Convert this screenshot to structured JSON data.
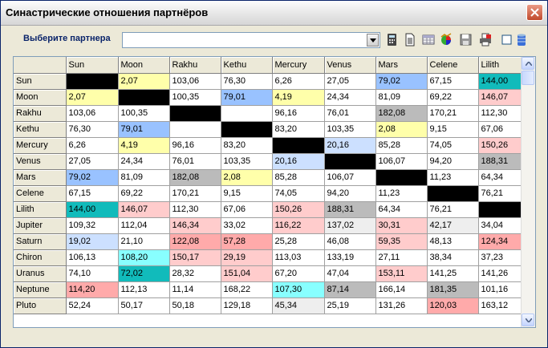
{
  "window": {
    "title": "Синастрические отношения партнёров"
  },
  "toolbar": {
    "partner_label": "Выберите партнера",
    "partner_value": "",
    "icons": [
      "calculator-icon",
      "document-icon",
      "table-icon",
      "chart-icon",
      "save-icon",
      "print-icon",
      "checkbox-icon",
      "database-icon"
    ]
  },
  "grid": {
    "columns": [
      "Sun",
      "Moon",
      "Rakhu",
      "Kethu",
      "Mercury",
      "Venus",
      "Mars",
      "Celene",
      "Lilith"
    ],
    "rows": [
      {
        "name": "Sun",
        "cells": [
          {
            "v": "",
            "c": "#000000"
          },
          {
            "v": "2,07",
            "c": "#ffffaa"
          },
          {
            "v": "103,06",
            "c": ""
          },
          {
            "v": "76,30",
            "c": ""
          },
          {
            "v": "6,26",
            "c": ""
          },
          {
            "v": "27,05",
            "c": ""
          },
          {
            "v": "79,02",
            "c": "#99c2ff"
          },
          {
            "v": "67,15",
            "c": ""
          },
          {
            "v": "144,00",
            "c": "#11bbbb"
          }
        ]
      },
      {
        "name": "Moon",
        "cells": [
          {
            "v": "2,07",
            "c": "#ffffaa"
          },
          {
            "v": "",
            "c": "#000000"
          },
          {
            "v": "100,35",
            "c": ""
          },
          {
            "v": "79,01",
            "c": "#99c2ff"
          },
          {
            "v": "4,19",
            "c": "#ffffaa"
          },
          {
            "v": "24,34",
            "c": ""
          },
          {
            "v": "81,09",
            "c": ""
          },
          {
            "v": "69,22",
            "c": ""
          },
          {
            "v": "146,07",
            "c": "#ffcccc"
          }
        ]
      },
      {
        "name": "Rakhu",
        "cells": [
          {
            "v": "103,06",
            "c": ""
          },
          {
            "v": "100,35",
            "c": ""
          },
          {
            "v": "",
            "c": "#000000"
          },
          {
            "v": "",
            "c": ""
          },
          {
            "v": "96,16",
            "c": ""
          },
          {
            "v": "76,01",
            "c": ""
          },
          {
            "v": "182,08",
            "c": "#bbbbbb"
          },
          {
            "v": "170,21",
            "c": ""
          },
          {
            "v": "112,30",
            "c": ""
          }
        ]
      },
      {
        "name": "Kethu",
        "cells": [
          {
            "v": "76,30",
            "c": ""
          },
          {
            "v": "79,01",
            "c": "#99c2ff"
          },
          {
            "v": "",
            "c": ""
          },
          {
            "v": "",
            "c": "#000000"
          },
          {
            "v": "83,20",
            "c": ""
          },
          {
            "v": "103,35",
            "c": ""
          },
          {
            "v": "2,08",
            "c": "#ffffaa"
          },
          {
            "v": "9,15",
            "c": ""
          },
          {
            "v": "67,06",
            "c": ""
          }
        ]
      },
      {
        "name": "Mercury",
        "cells": [
          {
            "v": "6,26",
            "c": ""
          },
          {
            "v": "4,19",
            "c": "#ffffaa"
          },
          {
            "v": "96,16",
            "c": ""
          },
          {
            "v": "83,20",
            "c": ""
          },
          {
            "v": "",
            "c": "#000000"
          },
          {
            "v": "20,16",
            "c": "#cce0ff"
          },
          {
            "v": "85,28",
            "c": ""
          },
          {
            "v": "74,05",
            "c": ""
          },
          {
            "v": "150,26",
            "c": "#ffcccc"
          }
        ]
      },
      {
        "name": "Venus",
        "cells": [
          {
            "v": "27,05",
            "c": ""
          },
          {
            "v": "24,34",
            "c": ""
          },
          {
            "v": "76,01",
            "c": ""
          },
          {
            "v": "103,35",
            "c": ""
          },
          {
            "v": "20,16",
            "c": "#cce0ff"
          },
          {
            "v": "",
            "c": "#000000"
          },
          {
            "v": "106,07",
            "c": ""
          },
          {
            "v": "94,20",
            "c": ""
          },
          {
            "v": "188,31",
            "c": "#bbbbbb"
          }
        ]
      },
      {
        "name": "Mars",
        "cells": [
          {
            "v": "79,02",
            "c": "#99c2ff"
          },
          {
            "v": "81,09",
            "c": ""
          },
          {
            "v": "182,08",
            "c": "#bbbbbb"
          },
          {
            "v": "2,08",
            "c": "#ffffaa"
          },
          {
            "v": "85,28",
            "c": ""
          },
          {
            "v": "106,07",
            "c": ""
          },
          {
            "v": "",
            "c": "#000000"
          },
          {
            "v": "11,23",
            "c": ""
          },
          {
            "v": "64,34",
            "c": ""
          }
        ]
      },
      {
        "name": "Celene",
        "cells": [
          {
            "v": "67,15",
            "c": ""
          },
          {
            "v": "69,22",
            "c": ""
          },
          {
            "v": "170,21",
            "c": ""
          },
          {
            "v": "9,15",
            "c": ""
          },
          {
            "v": "74,05",
            "c": ""
          },
          {
            "v": "94,20",
            "c": ""
          },
          {
            "v": "11,23",
            "c": ""
          },
          {
            "v": "",
            "c": "#000000"
          },
          {
            "v": "76,21",
            "c": ""
          }
        ]
      },
      {
        "name": "Lilith",
        "cells": [
          {
            "v": "144,00",
            "c": "#11bbbb"
          },
          {
            "v": "146,07",
            "c": "#ffcccc"
          },
          {
            "v": "112,30",
            "c": ""
          },
          {
            "v": "67,06",
            "c": ""
          },
          {
            "v": "150,26",
            "c": "#ffcccc"
          },
          {
            "v": "188,31",
            "c": "#bbbbbb"
          },
          {
            "v": "64,34",
            "c": ""
          },
          {
            "v": "76,21",
            "c": ""
          },
          {
            "v": "",
            "c": "#000000"
          }
        ]
      },
      {
        "name": "Jupiter",
        "cells": [
          {
            "v": "109,32",
            "c": ""
          },
          {
            "v": "112,04",
            "c": ""
          },
          {
            "v": "146,34",
            "c": "#ffcccc"
          },
          {
            "v": "33,02",
            "c": ""
          },
          {
            "v": "116,22",
            "c": "#ffcccc"
          },
          {
            "v": "137,02",
            "c": "#eeeeee"
          },
          {
            "v": "30,31",
            "c": "#ffcccc"
          },
          {
            "v": "42,17",
            "c": "#eeeeee"
          },
          {
            "v": "34,04",
            "c": ""
          }
        ]
      },
      {
        "name": "Saturn",
        "cells": [
          {
            "v": "19,02",
            "c": "#cce0ff"
          },
          {
            "v": "21,10",
            "c": ""
          },
          {
            "v": "122,08",
            "c": "#ffaaaa"
          },
          {
            "v": "57,28",
            "c": "#ffaaaa"
          },
          {
            "v": "25,28",
            "c": ""
          },
          {
            "v": "46,08",
            "c": ""
          },
          {
            "v": "59,35",
            "c": "#ffcccc"
          },
          {
            "v": "48,13",
            "c": ""
          },
          {
            "v": "124,34",
            "c": "#ffaaaa"
          }
        ]
      },
      {
        "name": "Chiron",
        "cells": [
          {
            "v": "106,13",
            "c": ""
          },
          {
            "v": "108,20",
            "c": "#88ffff"
          },
          {
            "v": "150,17",
            "c": "#ffcccc"
          },
          {
            "v": "29,19",
            "c": "#ffcccc"
          },
          {
            "v": "113,03",
            "c": ""
          },
          {
            "v": "133,19",
            "c": ""
          },
          {
            "v": "27,11",
            "c": ""
          },
          {
            "v": "38,34",
            "c": ""
          },
          {
            "v": "37,23",
            "c": ""
          }
        ]
      },
      {
        "name": "Uranus",
        "cells": [
          {
            "v": "74,10",
            "c": ""
          },
          {
            "v": "72,02",
            "c": "#11bbbb"
          },
          {
            "v": "28,32",
            "c": ""
          },
          {
            "v": "151,04",
            "c": "#ffcccc"
          },
          {
            "v": "67,20",
            "c": ""
          },
          {
            "v": "47,04",
            "c": ""
          },
          {
            "v": "153,11",
            "c": "#ffcccc"
          },
          {
            "v": "141,25",
            "c": ""
          },
          {
            "v": "141,26",
            "c": ""
          }
        ]
      },
      {
        "name": "Neptune",
        "cells": [
          {
            "v": "114,20",
            "c": "#ffaaaa"
          },
          {
            "v": "112,13",
            "c": ""
          },
          {
            "v": "11,14",
            "c": ""
          },
          {
            "v": "168,22",
            "c": ""
          },
          {
            "v": "107,30",
            "c": "#88ffff"
          },
          {
            "v": "87,14",
            "c": "#bbbbbb"
          },
          {
            "v": "166,14",
            "c": ""
          },
          {
            "v": "181,35",
            "c": "#bbbbbb"
          },
          {
            "v": "101,16",
            "c": ""
          }
        ]
      },
      {
        "name": "Pluto",
        "cells": [
          {
            "v": "52,24",
            "c": ""
          },
          {
            "v": "50,17",
            "c": ""
          },
          {
            "v": "50,18",
            "c": ""
          },
          {
            "v": "129,18",
            "c": ""
          },
          {
            "v": "45,34",
            "c": "#eeeeee"
          },
          {
            "v": "25,19",
            "c": ""
          },
          {
            "v": "131,26",
            "c": ""
          },
          {
            "v": "120,03",
            "c": "#ffaaaa"
          },
          {
            "v": "163,12",
            "c": ""
          }
        ]
      }
    ]
  }
}
